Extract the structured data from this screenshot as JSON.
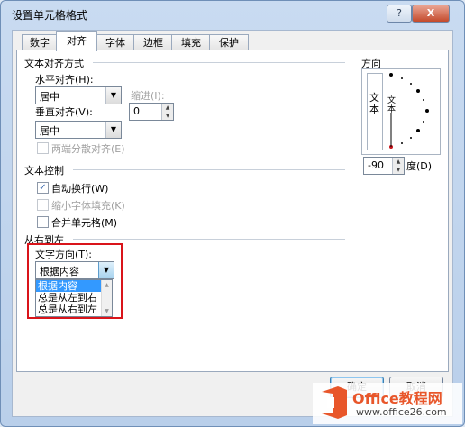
{
  "window": {
    "title": "设置单元格格式"
  },
  "titlebar_buttons": {
    "help": "?",
    "close": "X"
  },
  "tabs": [
    "数字",
    "对齐",
    "字体",
    "边框",
    "填充",
    "保护"
  ],
  "alignment": {
    "section": "文本对齐方式",
    "horizontal_label": "水平对齐(H):",
    "horizontal_value": "居中",
    "indent_label": "缩进(I):",
    "indent_value": "0",
    "vertical_label": "垂直对齐(V):",
    "vertical_value": "居中",
    "distributed_label": "两端分散对齐(E)"
  },
  "text_control": {
    "section": "文本控制",
    "wrap_label": "自动换行(W)",
    "wrap_checked": "✓",
    "shrink_label": "缩小字体填充(K)",
    "merge_label": "合并单元格(M)"
  },
  "rtl": {
    "section": "从右到左",
    "direction_label": "文字方向(T):",
    "direction_value": "根据内容",
    "options": [
      "根据内容",
      "总是从左到右",
      "总是从右到左"
    ]
  },
  "orientation": {
    "section": "方向",
    "vertical_text": "文本",
    "dial_text": "文本",
    "degrees_value": "-90",
    "degrees_label": "度(D)"
  },
  "buttons": {
    "ok": "确定",
    "cancel": "取消"
  },
  "watermark": {
    "brand": "Office教程网",
    "url": "www.office26.com"
  }
}
